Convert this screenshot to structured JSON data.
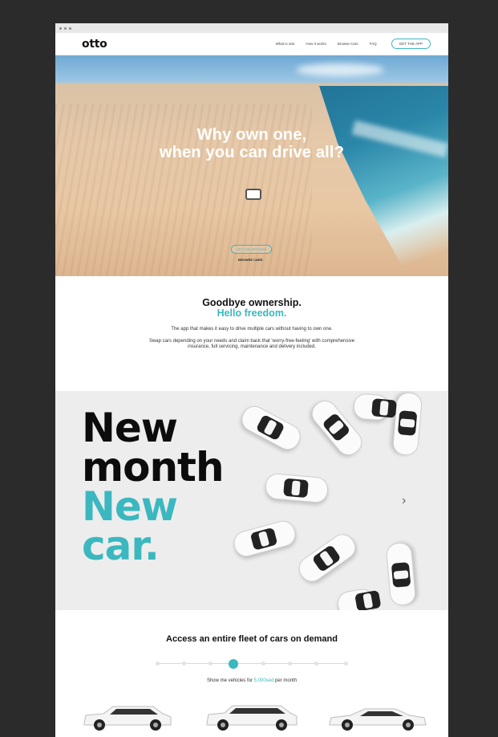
{
  "nav": {
    "logo": "otto",
    "links": [
      "What is otto",
      "How it works",
      "Browse Cars",
      "FAQ"
    ],
    "cta": "GET THE APP"
  },
  "hero": {
    "title_line1": "Why own one,",
    "title_line2": "when you can drive all?",
    "button": "GET THE APP NOW",
    "link": "BROWSE CARS"
  },
  "intro": {
    "heading1": "Goodbye ownership.",
    "heading2": "Hello freedom.",
    "para1": "The app that makes it easy to drive multiple cars without having to own one.",
    "para2": "Swap cars depending on your needs and claim back that 'worry-free-feeling' with comprehensive insurance, full servicing, maintenance and delivery included."
  },
  "promo": {
    "line1": "New",
    "line2": "month",
    "line3": "New",
    "line4": "car.",
    "next_icon": "chevron-right-icon"
  },
  "fleet": {
    "heading": "Access an entire fleet of cars on demand",
    "show_prefix": "Show me vehicles for",
    "show_value": "5,000sed",
    "show_suffix": "per month",
    "slider_level": 0.4
  },
  "colors": {
    "accent": "#3bb8bf",
    "dark": "#0c0c0c",
    "background": "#2b2b2b"
  }
}
